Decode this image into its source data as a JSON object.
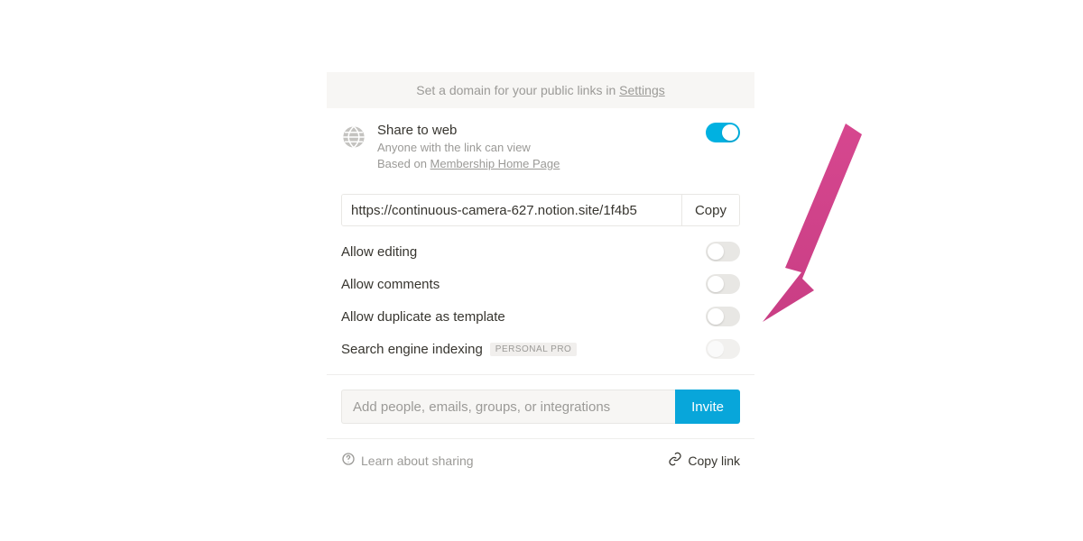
{
  "banner": {
    "prefix": "Set a domain for your public links in ",
    "link": "Settings"
  },
  "share": {
    "title": "Share to web",
    "subtitle": "Anyone with the link can view",
    "based_prefix": "Based on ",
    "based_link": "Membership Home Page",
    "enabled": true
  },
  "url": {
    "value": "https://continuous-camera-627.notion.site/1f4b5",
    "copy": "Copy"
  },
  "options": [
    {
      "label": "Allow editing",
      "state": "off"
    },
    {
      "label": "Allow comments",
      "state": "off"
    },
    {
      "label": "Allow duplicate as template",
      "state": "off"
    },
    {
      "label": "Search engine indexing",
      "state": "disabled",
      "badge": "PERSONAL PRO"
    }
  ],
  "invite": {
    "placeholder": "Add people, emails, groups, or integrations",
    "button": "Invite"
  },
  "footer": {
    "learn": "Learn about sharing",
    "copylink": "Copy link"
  },
  "colors": {
    "accent": "#00b1e1",
    "arrow": "#d6478f"
  }
}
